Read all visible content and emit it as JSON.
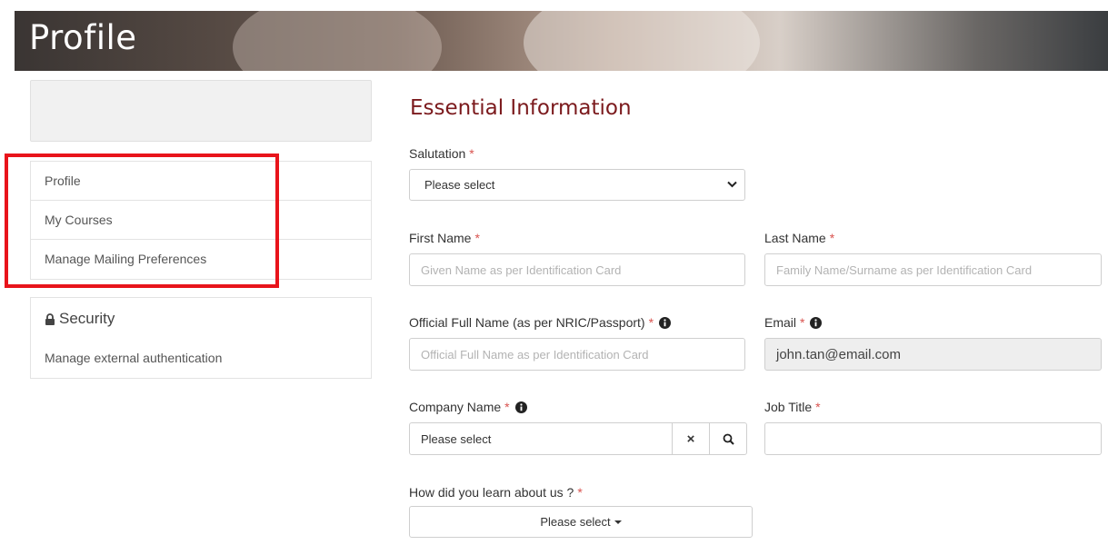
{
  "header": {
    "title": "Profile"
  },
  "sidebar": {
    "items": [
      {
        "label": "Profile"
      },
      {
        "label": "My Courses"
      },
      {
        "label": "Manage Mailing Preferences"
      }
    ],
    "security": {
      "title": "Security",
      "link": "Manage external authentication"
    }
  },
  "form": {
    "section_title": "Essential Information",
    "required_mark": "*",
    "salutation": {
      "label": "Salutation",
      "value": "Please select"
    },
    "first_name": {
      "label": "First Name",
      "placeholder": "Given Name as per Identification Card"
    },
    "last_name": {
      "label": "Last Name",
      "placeholder": "Family Name/Surname as per Identification Card"
    },
    "full_name": {
      "label": "Official Full Name (as per NRIC/Passport)",
      "placeholder": "Official Full Name as per Identification Card"
    },
    "email": {
      "label": "Email",
      "value": "john.tan@email.com"
    },
    "company": {
      "label": "Company Name",
      "value": "Please select",
      "clear_icon": "×"
    },
    "job_title": {
      "label": "Job Title",
      "value": ""
    },
    "learn_about": {
      "label": "How did you learn about us ?",
      "value": "Please select"
    }
  },
  "colors": {
    "accent": "#7b1a1d",
    "required": "#d9534f",
    "highlight": "#e8141b"
  }
}
